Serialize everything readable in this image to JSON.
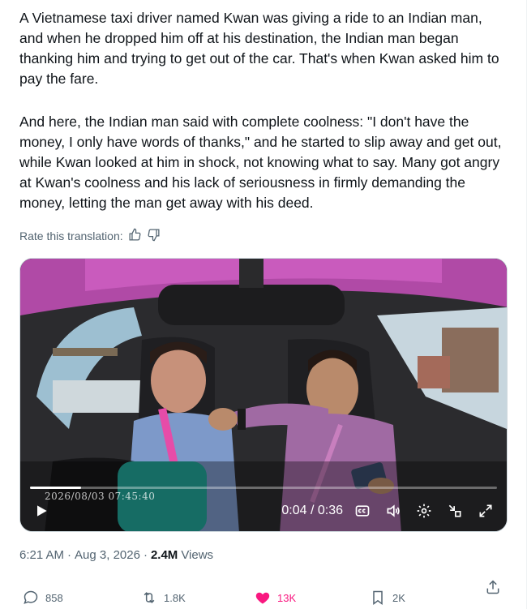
{
  "post": {
    "paragraph1": "A Vietnamese taxi driver named Kwan was giving a ride to an Indian man, and when he dropped him off at his destination, the Indian man began thanking him and trying to get out of the car. That's when Kwan asked him to pay the fare.",
    "paragraph2": "And here, the Indian man said with complete coolness: \"I don't have the money, I only have words of thanks,\" and he started to slip away and get out, while Kwan looked at him in shock, not knowing what to say. Many got angry at Kwan's coolness and his lack of seriousness in firmly demanding the money, letting the man get away with his deed.",
    "rate_label": "Rate this translation:"
  },
  "video": {
    "timestamp_overlay": "2026/08/03 07:45:40",
    "time_display": "0:04 / 0:36",
    "progress_fraction": 0.11,
    "icons": [
      "play-icon",
      "captions-icon",
      "volume-icon",
      "settings-icon",
      "minimize-icon",
      "fullscreen-icon"
    ]
  },
  "meta": {
    "time": "6:21 AM",
    "separator1": "·",
    "date": "Aug 3, 2026",
    "separator2": "·",
    "views_count": "2.4M",
    "views_label": "Views"
  },
  "actions": {
    "replies": "858",
    "reposts": "1.8K",
    "likes": "13K",
    "bookmarks": "2K"
  },
  "colors": {
    "like_active": "#f91880",
    "muted_text": "#536471",
    "primary_text": "#0f1419"
  }
}
